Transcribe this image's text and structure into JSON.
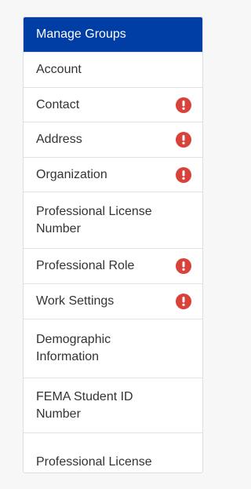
{
  "sidebar": {
    "items": [
      {
        "label": "Manage Groups",
        "active": true,
        "alert": false
      },
      {
        "label": "Account",
        "active": false,
        "alert": false
      },
      {
        "label": "Contact",
        "active": false,
        "alert": true
      },
      {
        "label": "Address",
        "active": false,
        "alert": true
      },
      {
        "label": "Organization",
        "active": false,
        "alert": true
      },
      {
        "label": "Professional License Number",
        "active": false,
        "alert": false
      },
      {
        "label": "Professional Role",
        "active": false,
        "alert": true
      },
      {
        "label": "Work Settings",
        "active": false,
        "alert": true
      },
      {
        "label": "Demographic Information",
        "active": false,
        "alert": false
      },
      {
        "label": "FEMA Student ID Number",
        "active": false,
        "alert": false
      },
      {
        "label": "Professional License",
        "active": false,
        "alert": false
      }
    ]
  },
  "colors": {
    "active_bg": "#003da5",
    "alert": "#d9423a"
  },
  "icons": {
    "alert": "exclamation-circle-icon"
  }
}
